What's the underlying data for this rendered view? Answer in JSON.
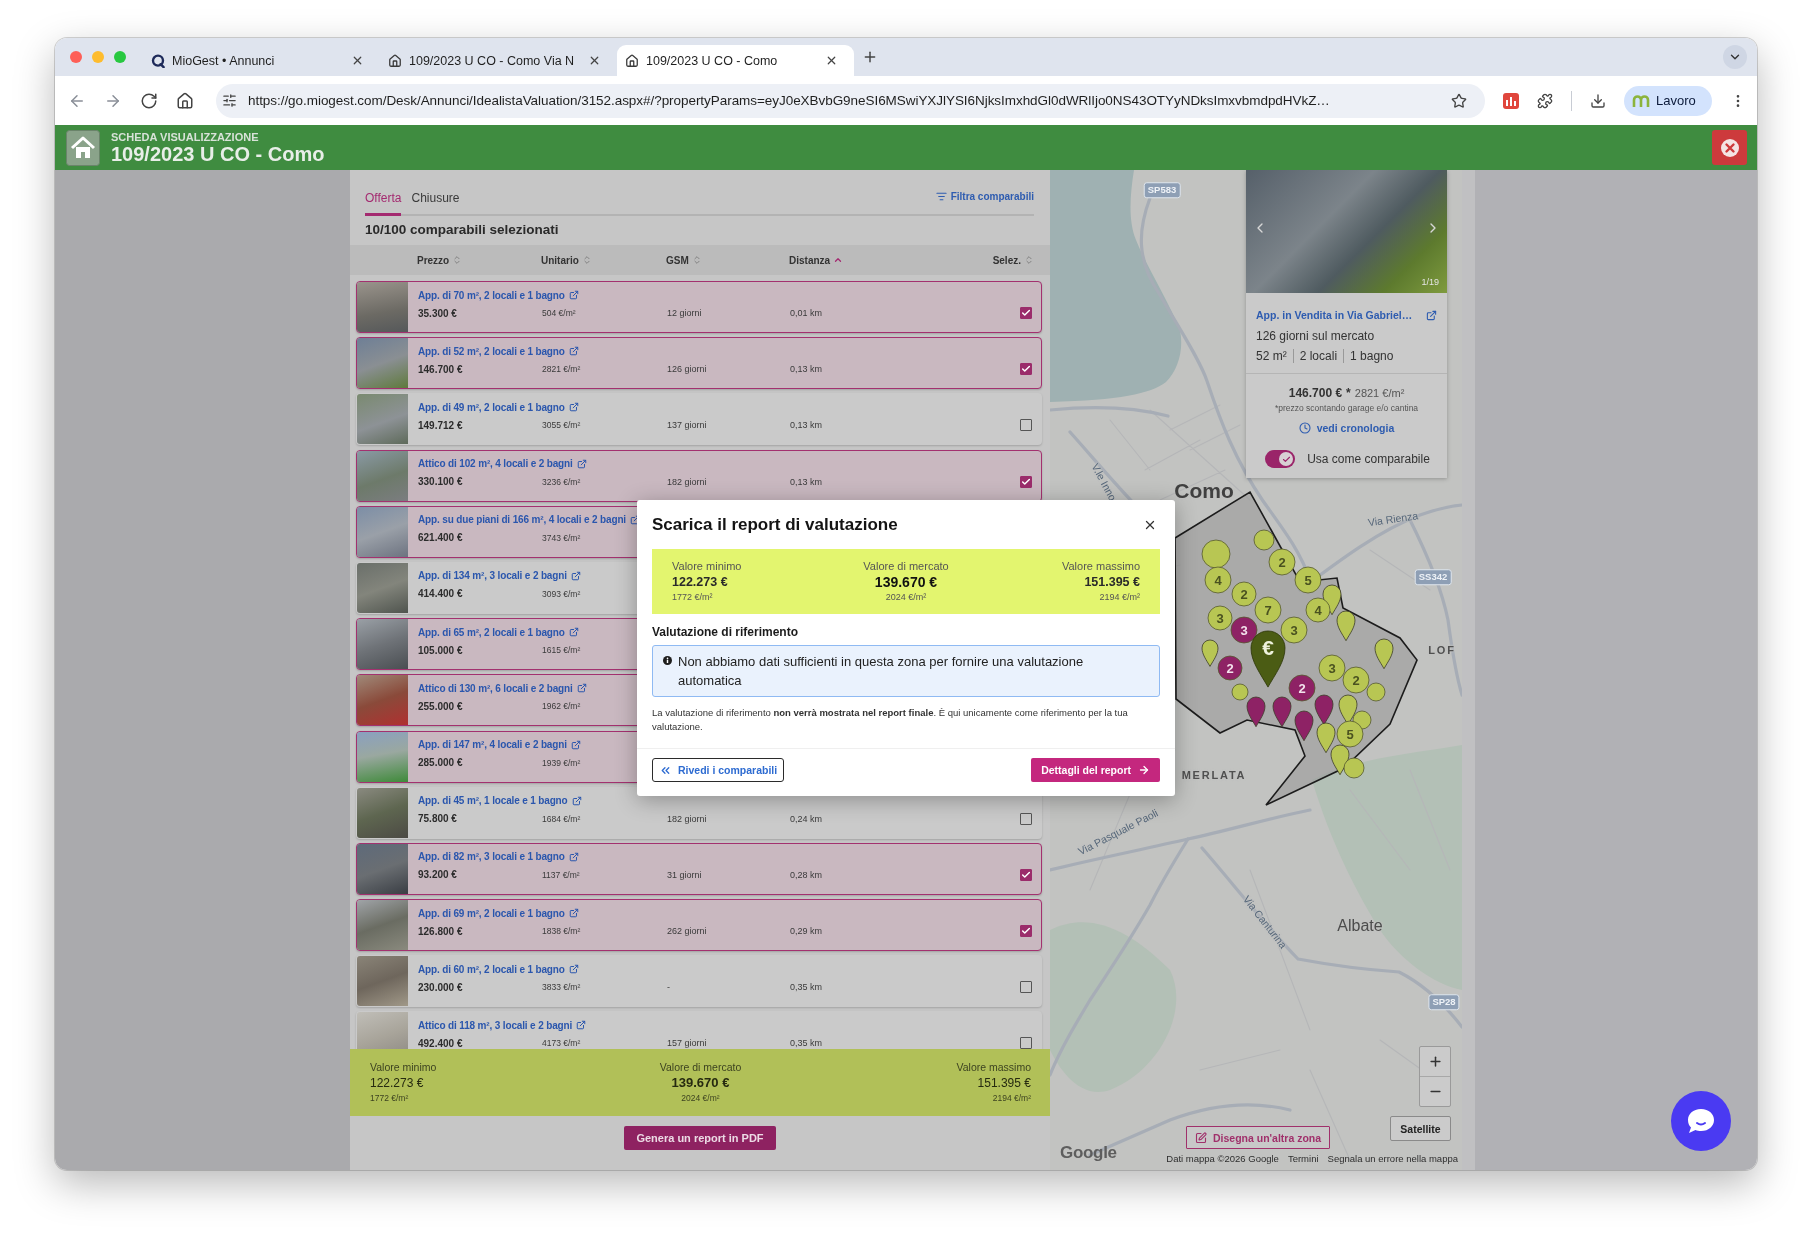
{
  "browser": {
    "tabs": [
      {
        "kind": "app",
        "title": "MioGest • Annunci",
        "selected": false
      },
      {
        "kind": "page",
        "title": "109/2023 U CO - Como Via N",
        "selected": false
      },
      {
        "kind": "page",
        "title": "109/2023 U CO - Como",
        "selected": true
      }
    ],
    "url": "https://go.miogest.com/Desk/Annunci/IdealistaValuation/3152.aspx#/?propertyParams=eyJ0eXBvbG9neSI6MSwiYXJlYSI6NjksImxhdGl0dWRlIjo0NS43OTYyNDksImxvbmdpdHVkZ…",
    "profile": "Lavoro"
  },
  "app_header": {
    "subtitle": "SCHEDA VISUALIZZAZIONE",
    "title": "109/2023 U CO - Como"
  },
  "list_panel": {
    "tabs": [
      {
        "label": "Offerta",
        "selected": true
      },
      {
        "label": "Chiusure",
        "selected": false
      }
    ],
    "filter_link": "Filtra comparabili",
    "selection_count": "10/100 comparabili selezionati",
    "columns": [
      {
        "label": "Prezzo",
        "sorted": false
      },
      {
        "label": "Unitario",
        "sorted": false
      },
      {
        "label": "GSM",
        "sorted": false
      },
      {
        "label": "Distanza",
        "sorted": true
      },
      {
        "label": "Selez.",
        "sorted": false
      }
    ],
    "rows": [
      {
        "title": "App. di 70 m², 2 locali e 1 bagno",
        "price": "35.300 €",
        "unit_price": "504 €/m²",
        "days": "12 giorni",
        "distance": "0,01 km",
        "selected": true,
        "checked": true
      },
      {
        "title": "App. di 52 m², 2 locali e 1 bagno",
        "price": "146.700 €",
        "unit_price": "2821 €/m²",
        "days": "126 giorni",
        "distance": "0,13 km",
        "selected": true,
        "checked": true
      },
      {
        "title": "App. di 49 m², 2 locali e 1 bagno",
        "price": "149.712 €",
        "unit_price": "3055 €/m²",
        "days": "137 giorni",
        "distance": "0,13 km",
        "selected": false,
        "checked": false
      },
      {
        "title": "Attico di 102 m², 4 locali e 2 bagni",
        "price": "330.100 €",
        "unit_price": "3236 €/m²",
        "days": "182 giorni",
        "distance": "0,13 km",
        "selected": true,
        "checked": true
      },
      {
        "title": "App. su due piani di 166 m², 4 locali e 2 bagni",
        "price": "621.400 €",
        "unit_price": "3743 €/m²",
        "selected": true
      },
      {
        "title": "App. di 134 m², 3 locali e 2 bagni",
        "price": "414.400 €",
        "unit_price": "3093 €/m²",
        "selected": false
      },
      {
        "title": "App. di 65 m², 2 locali e 1 bagno",
        "price": "105.000 €",
        "unit_price": "1615 €/m²",
        "selected": true
      },
      {
        "title": "Attico di 130 m², 6 locali e 2 bagni",
        "price": "255.000 €",
        "unit_price": "1962 €/m²",
        "selected": true
      },
      {
        "title": "App. di 147 m², 4 locali e 2 bagni",
        "price": "285.000 €",
        "unit_price": "1939 €/m²",
        "selected": true
      },
      {
        "title": "App. di 45 m², 1 locale e 1 bagno",
        "price": "75.800 €",
        "unit_price": "1684 €/m²",
        "days": "182 giorni",
        "distance": "0,24 km",
        "selected": false,
        "checked": false
      },
      {
        "title": "App. di 82 m², 3 locali e 1 bagno",
        "price": "93.200 €",
        "unit_price": "1137 €/m²",
        "days": "31 giorni",
        "distance": "0,28 km",
        "selected": true,
        "checked": true
      },
      {
        "title": "App. di 69 m², 2 locali e 1 bagno",
        "price": "126.800 €",
        "unit_price": "1838 €/m²",
        "days": "262 giorni",
        "distance": "0,29 km",
        "selected": true,
        "checked": true
      },
      {
        "title": "App. di 60 m², 2 locali e 1 bagno",
        "price": "230.000 €",
        "unit_price": "3833 €/m²",
        "days": "-",
        "distance": "0,35 km",
        "selected": false,
        "checked": false
      },
      {
        "title": "Attico di 118 m², 3 locali e 2 bagni",
        "price": "492.400 €",
        "unit_price": "4173 €/m²",
        "days": "157 giorni",
        "distance": "0,35 km",
        "selected": false,
        "checked": false
      }
    ],
    "summary": [
      {
        "label": "Valore minimo",
        "value": "122.273 €",
        "unit_value": "1772 €/m²"
      },
      {
        "label": "Valore di mercato",
        "value": "139.670 €",
        "unit_value": "2024 €/m²"
      },
      {
        "label": "Valore massimo",
        "value": "151.395 €",
        "unit_value": "2194 €/m²"
      }
    ],
    "pdf_button": "Genera un report in PDF"
  },
  "map": {
    "card": {
      "photo_counter": "1/19",
      "title": "App. in Vendita in Via Gabriel…",
      "days_on_market": "126 giorni sul mercato",
      "features": [
        "52 m²",
        "2 locali",
        "1 bagno"
      ],
      "price": "146.700 €",
      "price_mark": "*",
      "unit_price": "2821 €/m²",
      "footnote": "*prezzo scontando garage e/o cantina",
      "history_link": "vedi cronologia",
      "toggle": {
        "label": "Usa come comparabile",
        "on": true
      }
    },
    "labels": [
      {
        "kind": "road-badge",
        "text": "SP583"
      },
      {
        "kind": "street",
        "text": "V.le Inno"
      },
      {
        "kind": "city",
        "text": "Como"
      },
      {
        "kind": "street",
        "text": "Via Rienza"
      },
      {
        "kind": "road-badge",
        "text": "SS342"
      },
      {
        "kind": "district",
        "text": "LOF"
      },
      {
        "kind": "district",
        "text": "MERLATA"
      },
      {
        "kind": "street",
        "text": "Via Pasquale Paoli"
      },
      {
        "kind": "street",
        "text": "Via Canturina"
      },
      {
        "kind": "town",
        "text": "Albate"
      },
      {
        "kind": "road-badge",
        "text": "SP28"
      }
    ],
    "markers": [
      {
        "kind": "cluster",
        "color": "#b8c653"
      },
      {
        "kind": "cluster",
        "color": "#b8c653"
      },
      {
        "kind": "cluster",
        "color": "#b8c653",
        "label": "2"
      },
      {
        "kind": "cluster",
        "color": "#b8c653",
        "label": "4"
      },
      {
        "kind": "cluster",
        "color": "#b8c653",
        "label": "5"
      },
      {
        "kind": "cluster",
        "color": "#b8c653",
        "label": "2"
      },
      {
        "kind": "pin",
        "color": "#b8c653"
      },
      {
        "kind": "cluster",
        "color": "#b8c653",
        "label": "7"
      },
      {
        "kind": "cluster",
        "color": "#b8c653",
        "label": "4"
      },
      {
        "kind": "cluster",
        "color": "#b8c653",
        "label": "3"
      },
      {
        "kind": "pin",
        "color": "#b8c653"
      },
      {
        "kind": "cluster",
        "color": "#8e2265",
        "label": "3"
      },
      {
        "kind": "cluster",
        "color": "#b8c653",
        "label": "3"
      },
      {
        "kind": "pin",
        "color": "#b8c653"
      },
      {
        "kind": "main-pin",
        "color": "#4b5c14",
        "label": "€"
      },
      {
        "kind": "pin",
        "color": "#b8c653"
      },
      {
        "kind": "cluster",
        "color": "#8e2265",
        "label": "2"
      },
      {
        "kind": "cluster",
        "color": "#b8c653",
        "label": "3"
      },
      {
        "kind": "cluster",
        "color": "#b8c653",
        "label": "2"
      },
      {
        "kind": "cluster",
        "color": "#b8c653"
      },
      {
        "kind": "cluster",
        "color": "#8e2265",
        "label": "2"
      },
      {
        "kind": "cluster",
        "color": "#b8c653"
      },
      {
        "kind": "pin",
        "color": "#8e2265"
      },
      {
        "kind": "pin",
        "color": "#8e2265"
      },
      {
        "kind": "pin",
        "color": "#8e2265"
      },
      {
        "kind": "pin",
        "color": "#b8c653"
      },
      {
        "kind": "pin",
        "color": "#8e2265"
      },
      {
        "kind": "cluster",
        "color": "#b8c653"
      },
      {
        "kind": "pin",
        "color": "#b8c653"
      },
      {
        "kind": "cluster",
        "color": "#b8c653",
        "label": "5"
      },
      {
        "kind": "pin",
        "color": "#b8c653"
      },
      {
        "kind": "cluster",
        "color": "#b8c653"
      }
    ],
    "draw_button": "Disegna un'altra zona",
    "satellite_button": "Satellite",
    "logo": "Google",
    "attribution": [
      "Dati mappa ©2026 Google",
      "Termini",
      "Segnala un errore nella mappa"
    ]
  },
  "modal": {
    "title": "Scarica il report di valutazione",
    "values": [
      {
        "label": "Valore minimo",
        "value": "122.273 €",
        "unit_value": "1772 €/m²"
      },
      {
        "label": "Valore di mercato",
        "value": "139.670 €",
        "unit_value": "2024 €/m²"
      },
      {
        "label": "Valore massimo",
        "value": "151.395 €",
        "unit_value": "2194 €/m²"
      }
    ],
    "section_title": "Valutazione di riferimento",
    "info_message": "Non abbiamo dati sufficienti in questa zona per fornire una valutazione automatica",
    "note": "La valutazione di riferimento **non verrà mostrata nel report finale**. È qui unicamente come riferimento per la tua valutazione.",
    "back_button": "Rivedi i comparabili",
    "primary_button": "Dettagli del report"
  }
}
